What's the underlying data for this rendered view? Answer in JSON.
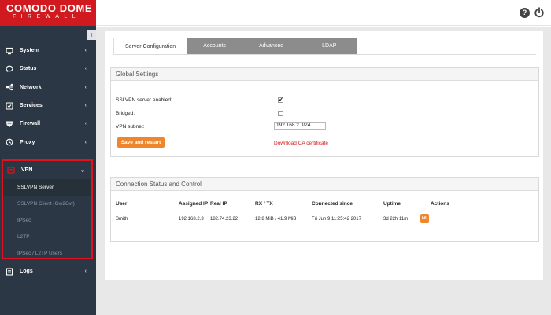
{
  "logo": {
    "main": "COMODO DOME",
    "sub": "FIREWALL"
  },
  "sidebar": {
    "collapse_glyph": "‹",
    "items": [
      {
        "label": "System",
        "icon": "monitor-icon"
      },
      {
        "label": "Status",
        "icon": "chat-bubble-icon"
      },
      {
        "label": "Network",
        "icon": "network-icon"
      },
      {
        "label": "Services",
        "icon": "services-icon"
      },
      {
        "label": "Firewall",
        "icon": "shield-icon"
      },
      {
        "label": "Proxy",
        "icon": "proxy-icon"
      }
    ],
    "chevron": "‹",
    "vpn": {
      "label": "VPN",
      "chevron": "⌄",
      "subitems": [
        "SSLVPN Server",
        "SSLVPN Client (Gw2Gw)",
        "IPSec",
        "L2TP",
        "IPSec / L2TP Users"
      ]
    },
    "logs": {
      "label": "Logs"
    }
  },
  "topbar": {
    "help": "?"
  },
  "tabs": [
    "Server Configuration",
    "Accounts",
    "Advanced",
    "LDAP"
  ],
  "global_settings": {
    "title": "Global Settings",
    "sslvpn_label": "SSLVPN server enabled:",
    "sslvpn_checked": "✔",
    "bridged_label": "Bridged:",
    "vpn_subnet_label": "VPN subnet:",
    "vpn_subnet_value": "192.168.2.0/24",
    "save_button": "Save and restart",
    "download_link": "Download CA certificate"
  },
  "connection": {
    "title": "Connection Status and Control",
    "headers": [
      "User",
      "Assigned IP",
      "Real IP",
      "RX / TX",
      "Connected since",
      "Uptime",
      "Actions"
    ],
    "rows": [
      [
        "Smith",
        "192.168.2.3",
        "182.74.23.22",
        "12.8 MiB / 41.9 MiB",
        "Fri Jun 9 11:25:42 2017",
        "3d 22h 11m",
        "kill"
      ]
    ]
  },
  "colors": {
    "brand_red": "#d11a1f",
    "sidebar_bg": "#2b3744",
    "accent_orange": "#f0862b"
  }
}
